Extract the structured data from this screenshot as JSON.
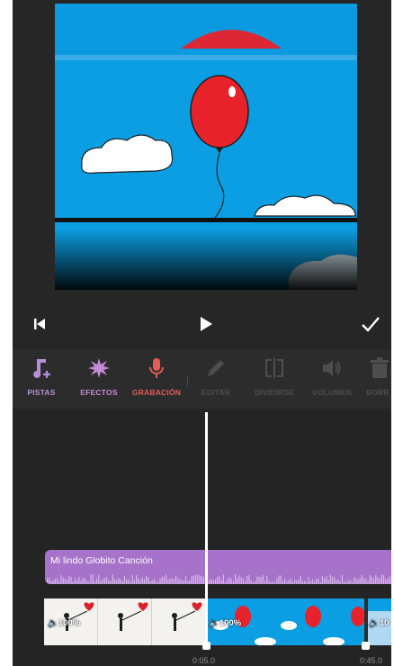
{
  "controls": {
    "rewind_icon": "skip-to-start-icon",
    "play_icon": "play-icon",
    "confirm_icon": "checkmark-icon"
  },
  "toolbar": {
    "tools": [
      {
        "label": "PISTAS",
        "icon": "music-note-plus-icon",
        "color": "#b78fd9"
      },
      {
        "label": "EFECTOS",
        "icon": "sparkle-burst-icon",
        "color": "#c58ad8"
      },
      {
        "label": "GRABACIÓN",
        "icon": "microphone-icon",
        "color": "#e45c5c"
      },
      {
        "label": "EDITAR",
        "icon": "pencil-icon",
        "color": "#4e4e4e"
      },
      {
        "label": "DIVIDIRSE",
        "icon": "split-icon",
        "color": "#4e4e4e"
      },
      {
        "label": "VOLUMEN",
        "icon": "speaker-icon",
        "color": "#4e4e4e"
      },
      {
        "label": "BORR",
        "icon": "trash-icon",
        "color": "#4e4e4e"
      }
    ]
  },
  "timeline": {
    "audio_clip": {
      "title": "Mi lindo Globito Canción",
      "color": "#a772c9"
    },
    "video_clips": [
      {
        "volume": "100%"
      },
      {
        "volume": "100%"
      },
      {
        "volume": "10"
      }
    ],
    "playhead_time": "0:05.0",
    "end_time": "0:45.0"
  }
}
